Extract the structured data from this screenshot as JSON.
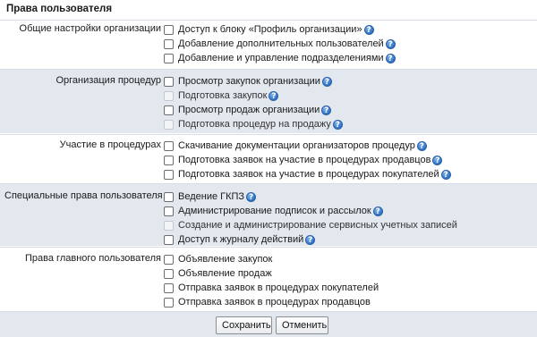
{
  "title": "Права пользователя",
  "help_glyph": "?",
  "sections": [
    {
      "label": "Общие настройки организации",
      "items": [
        {
          "label": "Доступ к блоку «Профиль организации»",
          "help": true,
          "disabled": false
        },
        {
          "label": "Добавление дополнительных пользователей",
          "help": true,
          "disabled": false
        },
        {
          "label": "Добавление и управление подразделениями",
          "help": true,
          "disabled": false
        }
      ]
    },
    {
      "label": "Организация процедур",
      "items": [
        {
          "label": "Просмотр закупок организации",
          "help": true,
          "disabled": false
        },
        {
          "label": "Подготовка закупок",
          "help": true,
          "disabled": true
        },
        {
          "label": "Просмотр продаж организации",
          "help": true,
          "disabled": false
        },
        {
          "label": "Подготовка процедур на продажу",
          "help": true,
          "disabled": true
        }
      ]
    },
    {
      "label": "Участие в процедурах",
      "items": [
        {
          "label": "Скачивание документации организаторов процедур",
          "help": true,
          "disabled": false
        },
        {
          "label": "Подготовка заявок на участие в процедурах продавцов",
          "help": true,
          "disabled": false
        },
        {
          "label": "Подготовка заявок на участие в процедурах покупателей",
          "help": true,
          "disabled": false
        }
      ]
    },
    {
      "label": "Специальные права пользователя",
      "items": [
        {
          "label": "Ведение ГКПЗ",
          "help": true,
          "disabled": false
        },
        {
          "label": "Администрирование подписок и рассылок",
          "help": true,
          "disabled": false
        },
        {
          "label": "Создание и администрирование сервисных учетных записей",
          "help": false,
          "disabled": true
        },
        {
          "label": "Доступ к журналу действий",
          "help": true,
          "disabled": false
        }
      ]
    },
    {
      "label": "Права главного пользователя",
      "items": [
        {
          "label": "Объявление закупок",
          "help": false,
          "disabled": false
        },
        {
          "label": "Объявление продаж",
          "help": false,
          "disabled": false
        },
        {
          "label": "Отправка заявок в процедурах покупателей",
          "help": false,
          "disabled": false
        },
        {
          "label": "Отправка заявок в процедурах продавцов",
          "help": false,
          "disabled": false
        }
      ]
    }
  ],
  "buttons": {
    "save": "Сохранить",
    "cancel": "Отменить"
  }
}
